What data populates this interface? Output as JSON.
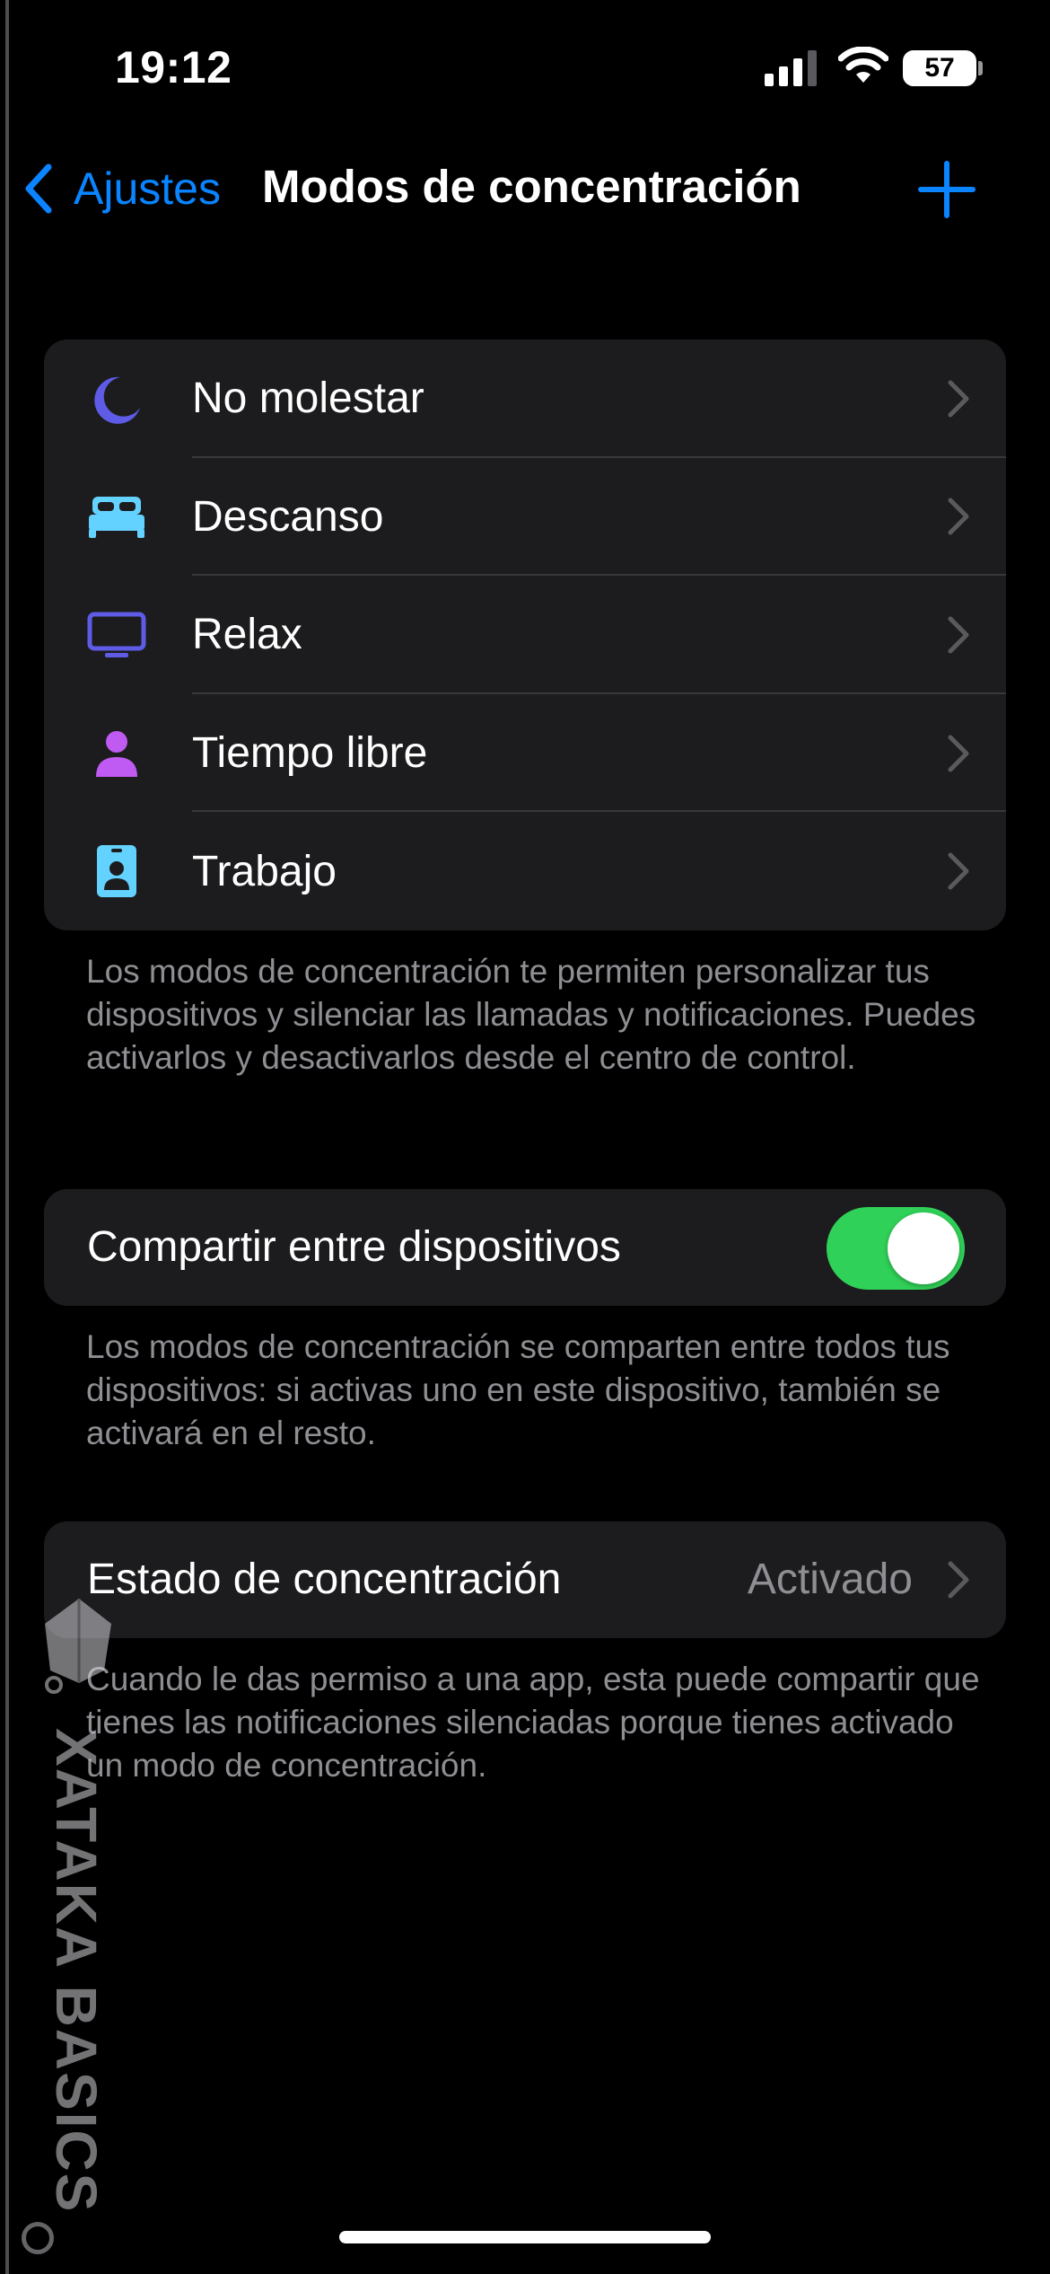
{
  "status_bar": {
    "time": "19:12",
    "battery": "57",
    "icons": [
      "signal-icon",
      "wifi-icon",
      "battery-icon"
    ]
  },
  "nav": {
    "back_label": "Ajustes",
    "title": "Modos de concentración",
    "add_icon": "plus-icon"
  },
  "colors": {
    "accent": "#0a84ff",
    "toggle_on": "#30d158",
    "group_bg": "#1c1c1e",
    "secondary_text": "#8e8e93",
    "moon": "#5e5ce6",
    "bed": "#64d2ff",
    "tv": "#5e5ce6",
    "person": "#bf5af2",
    "badge": "#64d2ff"
  },
  "modes": [
    {
      "label": "No molestar",
      "icon": "moon-icon"
    },
    {
      "label": "Descanso",
      "icon": "bed-icon"
    },
    {
      "label": "Relax",
      "icon": "tv-icon"
    },
    {
      "label": "Tiempo libre",
      "icon": "person-icon"
    },
    {
      "label": "Trabajo",
      "icon": "id-badge-icon"
    }
  ],
  "modes_footnote": "Los modos de concentración te permiten personalizar tus dispositivos y silenciar las llamadas y notificaciones. Puedes activarlos y desactivarlos desde el centro de control.",
  "share": {
    "label": "Compartir entre dispositivos",
    "enabled": true,
    "footnote": "Los modos de concentración se comparten entre todos tus dispositivos: si activas uno en este dispositivo, también se activará en el resto."
  },
  "focus_status": {
    "label": "Estado de concentración",
    "value": "Activado",
    "footnote": "Cuando le das permiso a una app, esta puede compartir que tienes las notificaciones silenciadas porque tienes activado un modo de concentración."
  },
  "watermark": {
    "text": "XATAKA BASICS"
  }
}
